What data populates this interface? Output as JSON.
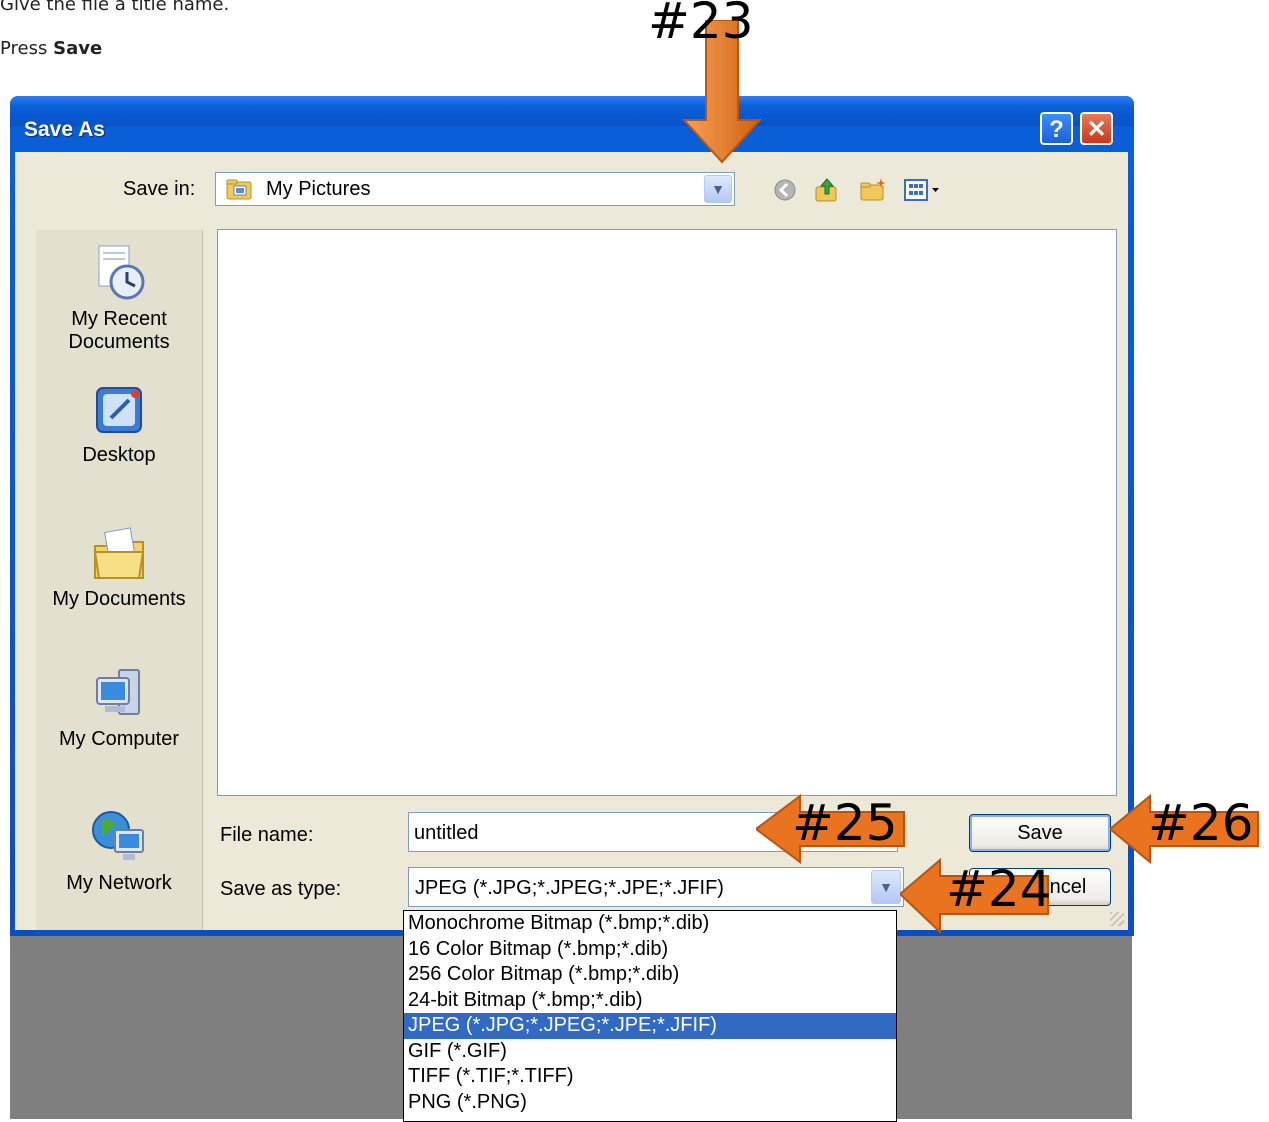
{
  "instructions": {
    "line1": "Give the file a title name.",
    "line2_prefix": "Press ",
    "line2_bold": "Save"
  },
  "dialog": {
    "title": "Save As",
    "help_glyph": "?",
    "close_glyph": "✕",
    "save_in": {
      "label": "Save in:",
      "value": "My Pictures"
    },
    "toolbar_icons": [
      "back-icon",
      "up-folder-icon",
      "new-folder-icon",
      "views-menu-icon"
    ],
    "places": [
      {
        "label_line1": "My Recent",
        "label_line2": "Documents",
        "icon": "recent-documents-icon"
      },
      {
        "label_line1": "Desktop",
        "label_line2": "",
        "icon": "desktop-icon"
      },
      {
        "label_line1": "My Documents",
        "label_line2": "",
        "icon": "my-documents-icon"
      },
      {
        "label_line1": "My Computer",
        "label_line2": "",
        "icon": "my-computer-icon"
      },
      {
        "label_line1": "My Network",
        "label_line2": "",
        "icon": "my-network-icon"
      }
    ],
    "file_name": {
      "label": "File name:",
      "value": "untitled"
    },
    "save_as_type": {
      "label": "Save as type:",
      "value": "JPEG (*.JPG;*.JPEG;*.JPE;*.JFIF)",
      "options": [
        "Monochrome Bitmap (*.bmp;*.dib)",
        "16 Color Bitmap (*.bmp;*.dib)",
        "256 Color Bitmap (*.bmp;*.dib)",
        "24-bit Bitmap (*.bmp;*.dib)",
        "JPEG (*.JPG;*.JPEG;*.JPE;*.JFIF)",
        "GIF (*.GIF)",
        "TIFF (*.TIF;*.TIFF)",
        "PNG (*.PNG)"
      ],
      "selected_index": 4
    },
    "save_button": "Save",
    "cancel_button_visible": "ncel"
  },
  "annotations": {
    "c23": "#23",
    "c24": "#24",
    "c25": "#25",
    "c26": "#26",
    "arrow_color": "#e9731e"
  },
  "colors": {
    "titlebar": "#0a5fd8",
    "dialog_bg": "#ece9d8",
    "selection": "#316ac5",
    "backdrop": "#7f7f7f"
  }
}
